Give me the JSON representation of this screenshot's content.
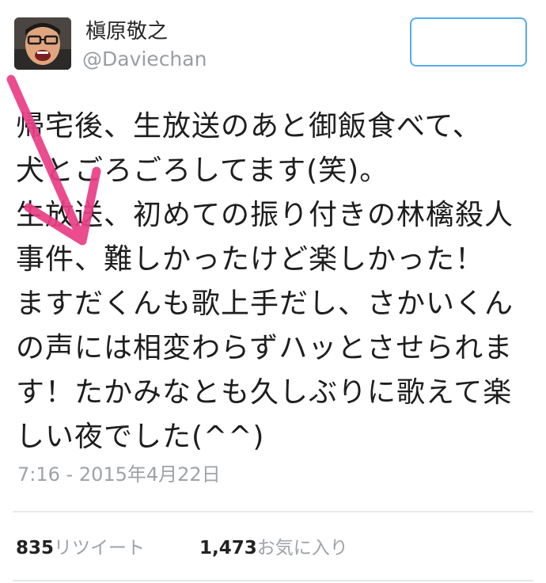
{
  "tweet": {
    "author": {
      "display_name": "槇原敬之",
      "handle": "@Daviechan",
      "avatar_icon": "user-avatar-photo"
    },
    "follow_button": {
      "label": "",
      "border_color": "#55acee"
    },
    "text": "帰宅後、生放送のあと御飯食べて、\n犬とごろごろしてます(笑)。\n生放送、初めての振り付きの林檎殺人\n事件、難しかったけど楽しかった！\nますだくんも歌上手だし、さかいくん\nの声には相変わらずハッとさせられま\nす！たかみなとも久しぶりに歌えて楽\nしい夜でした(^^)",
    "timestamp": "7:16 - 2015年4月22日",
    "stats": {
      "retweets": {
        "count": "835",
        "label": "リツイート"
      },
      "favorites": {
        "count": "1,473",
        "label": "お気に入り"
      }
    }
  },
  "annotation": {
    "arrow_icon": "pink-arrow-icon",
    "color": "#ea3f86"
  }
}
